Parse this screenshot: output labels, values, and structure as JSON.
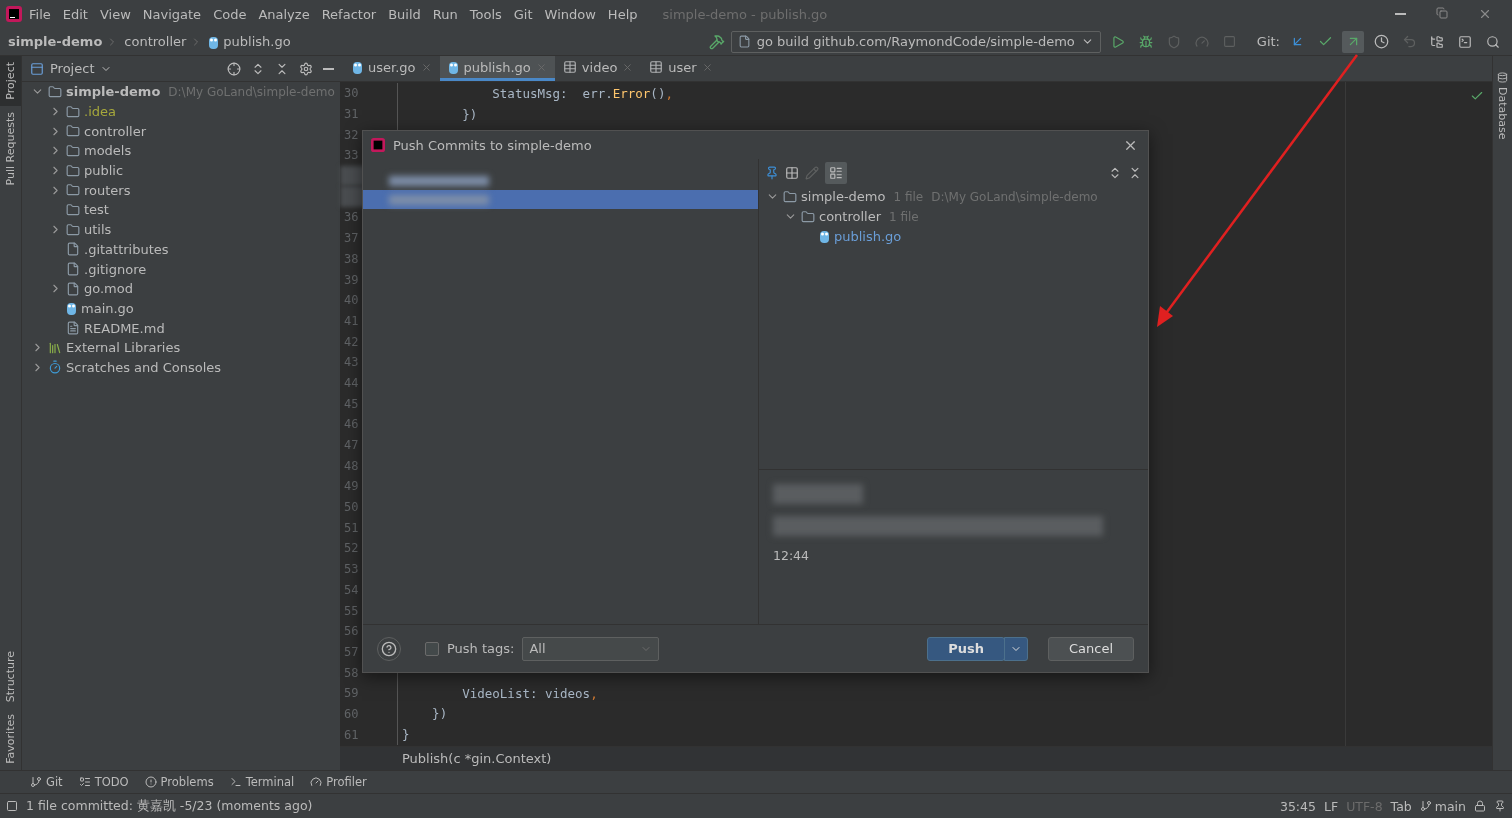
{
  "window": {
    "title": "simple-demo - publish.go",
    "menu": [
      "File",
      "Edit",
      "View",
      "Navigate",
      "Code",
      "Analyze",
      "Refactor",
      "Build",
      "Run",
      "Tools",
      "Git",
      "Window",
      "Help"
    ]
  },
  "breadcrumb": [
    "simple-demo",
    "controller",
    "publish.go"
  ],
  "run_config": "go build github.com/RaymondCode/simple-demo",
  "git": {
    "label": "Git:",
    "actions": [
      {
        "kind": "update",
        "selected": false
      },
      {
        "kind": "commit",
        "selected": false
      },
      {
        "kind": "push",
        "selected": true
      },
      {
        "kind": "history",
        "selected": false
      },
      {
        "kind": "rollback",
        "selected": false
      }
    ]
  },
  "left_stripe": {
    "top": [
      {
        "label": "Project",
        "selected": true
      },
      {
        "label": "Pull Requests",
        "selected": false
      }
    ],
    "bottom": [
      {
        "label": "Structure",
        "selected": false
      },
      {
        "label": "Favorites",
        "selected": false
      }
    ]
  },
  "right_stripe": [
    "Database"
  ],
  "project": {
    "title": "Project",
    "tree": [
      {
        "label": "simple-demo",
        "note": "D:\\My GoLand\\simple-demo",
        "kind": "module",
        "expandable": true,
        "expanded": true,
        "ignored": false,
        "children": [
          {
            "label": ".idea",
            "kind": "folder",
            "expandable": true,
            "expanded": false,
            "ignored": true
          },
          {
            "label": "controller",
            "kind": "folder",
            "expandable": true,
            "expanded": false,
            "ignored": false
          },
          {
            "label": "models",
            "kind": "folder",
            "expandable": true,
            "expanded": false,
            "ignored": false
          },
          {
            "label": "public",
            "kind": "folder",
            "expandable": true,
            "expanded": false,
            "ignored": false
          },
          {
            "label": "routers",
            "kind": "folder",
            "expandable": true,
            "expanded": false,
            "ignored": false
          },
          {
            "label": "test",
            "kind": "folder",
            "expandable": false,
            "ignored": false
          },
          {
            "label": "utils",
            "kind": "folder",
            "expandable": true,
            "expanded": false,
            "ignored": false
          },
          {
            "label": ".gitattributes",
            "kind": "file",
            "expandable": false,
            "ignored": false
          },
          {
            "label": ".gitignore",
            "kind": "file",
            "expandable": false,
            "ignored": false
          },
          {
            "label": "go.mod",
            "kind": "file",
            "expandable": true,
            "expanded": false,
            "ignored": false
          },
          {
            "label": "main.go",
            "kind": "go",
            "expandable": false,
            "ignored": false
          },
          {
            "label": "README.md",
            "kind": "markdown",
            "expandable": false,
            "ignored": false
          }
        ]
      },
      {
        "label": "External Libraries",
        "kind": "libraries",
        "expandable": true,
        "expanded": false,
        "ignored": false
      },
      {
        "label": "Scratches and Consoles",
        "kind": "scratches",
        "expandable": true,
        "expanded": false,
        "ignored": false
      }
    ]
  },
  "tabs": [
    {
      "label": "user.go",
      "kind": "go",
      "selected": false
    },
    {
      "label": "publish.go",
      "kind": "go",
      "selected": true
    },
    {
      "label": "video",
      "kind": "table",
      "selected": false
    },
    {
      "label": "user",
      "kind": "table",
      "selected": false
    }
  ],
  "editor": {
    "lines": [
      {
        "kind": "code",
        "number": "30",
        "code": [
          {
            "kind": "plain",
            "text": "            StatusMsg:  err."
          },
          {
            "kind": "method",
            "text": "Error"
          },
          {
            "kind": "plain",
            "text": "()"
          },
          {
            "kind": "punct",
            "text": ","
          }
        ]
      },
      {
        "kind": "code",
        "number": "31",
        "code": [
          {
            "kind": "plain",
            "text": "        })"
          }
        ]
      },
      {
        "kind": "code",
        "number": "32"
      },
      {
        "kind": "code",
        "number": "33"
      },
      {
        "kind": "blurred"
      },
      {
        "kind": "blurred"
      },
      {
        "kind": "code",
        "number": "36"
      },
      {
        "kind": "code",
        "number": "37"
      },
      {
        "kind": "code",
        "number": "38"
      },
      {
        "kind": "code",
        "number": "39"
      },
      {
        "kind": "code",
        "number": "40"
      },
      {
        "kind": "code",
        "number": "41"
      },
      {
        "kind": "code",
        "number": "42"
      },
      {
        "kind": "code",
        "number": "43"
      },
      {
        "kind": "code",
        "number": "44"
      },
      {
        "kind": "code",
        "number": "45"
      },
      {
        "kind": "code",
        "number": "46"
      },
      {
        "kind": "code",
        "number": "47"
      },
      {
        "kind": "code",
        "number": "48"
      },
      {
        "kind": "code",
        "number": "49"
      },
      {
        "kind": "code",
        "number": "50"
      },
      {
        "kind": "code",
        "number": "51"
      },
      {
        "kind": "code",
        "number": "52"
      },
      {
        "kind": "code",
        "number": "53"
      },
      {
        "kind": "code",
        "number": "54"
      },
      {
        "kind": "code",
        "number": "55"
      },
      {
        "kind": "code",
        "number": "56"
      },
      {
        "kind": "code",
        "number": "57"
      },
      {
        "kind": "code",
        "number": "58"
      },
      {
        "kind": "code",
        "number": "59",
        "code": [
          {
            "kind": "plain",
            "text": "        VideoList: videos"
          },
          {
            "kind": "punct",
            "text": ","
          }
        ]
      },
      {
        "kind": "code",
        "number": "60",
        "code": [
          {
            "kind": "plain",
            "text": "    })"
          }
        ]
      },
      {
        "kind": "code",
        "number": "61",
        "code": [
          {
            "kind": "plain",
            "text": "}"
          }
        ]
      }
    ],
    "context": "Publish(c *gin.Context)"
  },
  "dialog": {
    "title": "Push Commits to simple-demo",
    "commits": [
      {
        "selected": false
      },
      {
        "selected": true
      }
    ],
    "tree": [
      {
        "label": "simple-demo",
        "note": "1 file",
        "path": "D:\\My GoLand\\simple-demo",
        "kind": "module",
        "children": [
          {
            "label": "controller",
            "note": "1 file",
            "kind": "folder",
            "children": [
              {
                "label": "publish.go",
                "kind": "go"
              }
            ]
          }
        ]
      }
    ],
    "details": {
      "time": "12:44"
    },
    "push_tags": {
      "label": "Push tags:",
      "checked": false,
      "value": "All"
    },
    "buttons": [
      {
        "label": "Push",
        "kind": "primary"
      },
      {
        "label": "Cancel",
        "kind": "secondary"
      }
    ]
  },
  "tool_windows": [
    {
      "label": "Git",
      "kind": "git"
    },
    {
      "label": "TODO",
      "kind": "todo"
    },
    {
      "label": "Problems",
      "kind": "problems"
    },
    {
      "label": "Terminal",
      "kind": "terminal"
    },
    {
      "label": "Profiler",
      "kind": "profiler"
    }
  ],
  "status": {
    "message": "1 file committed: 黄嘉凯 -5/23 (moments ago)",
    "items": [
      "35:45",
      "LF",
      "UTF-8",
      "Tab"
    ],
    "branch": "main"
  }
}
